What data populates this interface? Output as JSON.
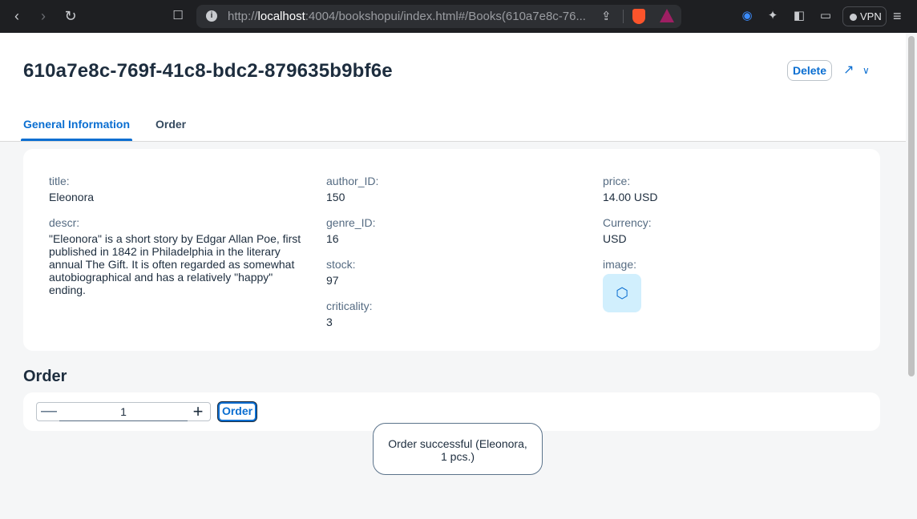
{
  "browser": {
    "url_prefix": "http://",
    "url_host": "localhost",
    "url_rest": ":4004/bookshopui/index.html#/Books(610a7e8c-76...",
    "vpn_label": "VPN"
  },
  "header": {
    "title": "610a7e8c-769f-41c8-bdc2-879635b9bf6e",
    "delete_label": "Delete",
    "tabs": [
      {
        "label": "General Information",
        "selected": true
      },
      {
        "label": "Order",
        "selected": false
      }
    ]
  },
  "general": {
    "title_label": "title:",
    "title_value": "Eleonora",
    "descr_label": "descr:",
    "descr_value": "\"Eleonora\" is a short story by Edgar Allan Poe, first published in 1842 in Philadelphia in the literary annual The Gift. It is often regarded as somewhat autobiographical and has a relatively \"happy\" ending.",
    "author_label": "author_ID:",
    "author_value": "150",
    "genre_label": "genre_ID:",
    "genre_value": "16",
    "stock_label": "stock:",
    "stock_value": "97",
    "criticality_label": "criticality:",
    "criticality_value": "3",
    "price_label": "price:",
    "price_value": "14.00 USD",
    "currency_label": "Currency:",
    "currency_value": "USD",
    "image_label": "image:"
  },
  "order": {
    "section_title": "Order",
    "quantity": "1",
    "button_label": "Order"
  },
  "toast": {
    "line1": "Order successful (Eleonora,",
    "line2": "1 pcs.)"
  }
}
